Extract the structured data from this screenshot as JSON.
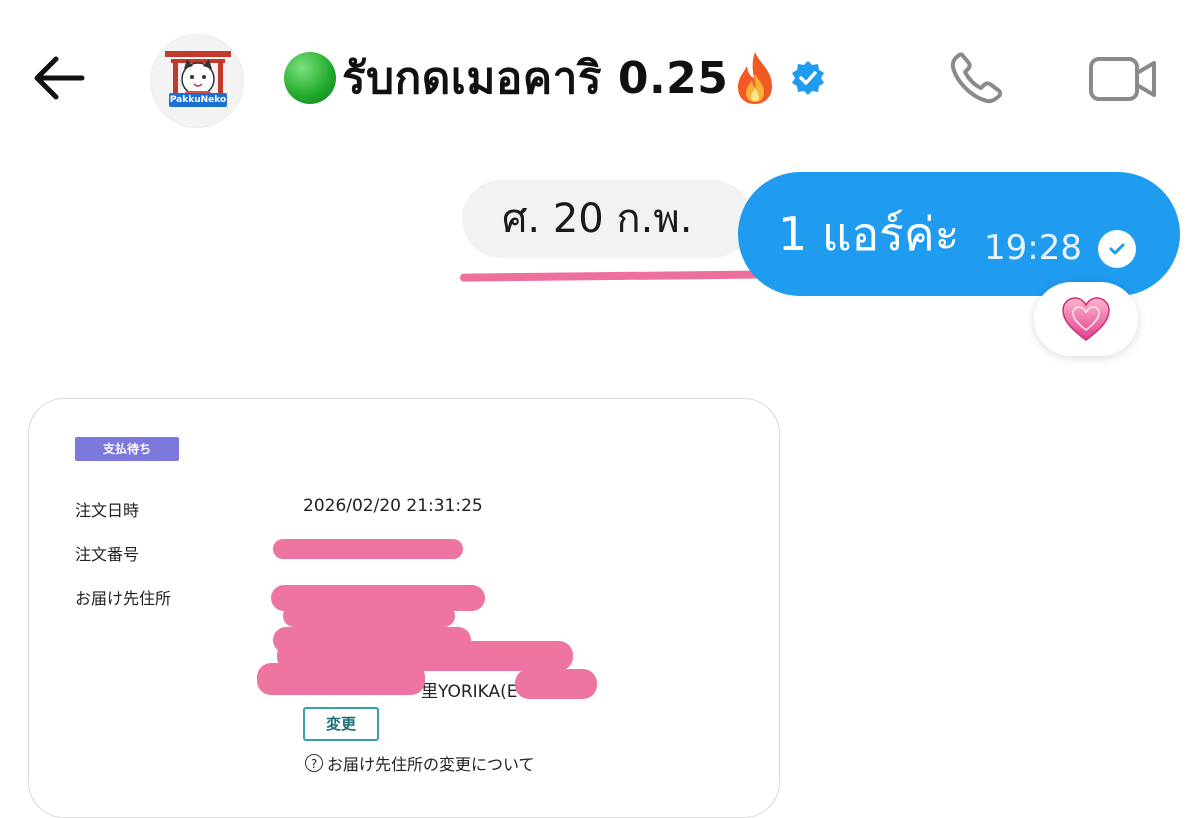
{
  "header": {
    "back_icon": "arrow-left-icon",
    "avatar_label": "PakkuNeko",
    "chat_title": "รับกดเมอคาริ 0.25",
    "status_color": "#1fa82a",
    "verified_color": "#1f9bf0",
    "call_icon": "phone-icon",
    "video_icon": "video-camera-icon"
  },
  "conversation": {
    "date_separator": "ศ. 20 ก.พ.",
    "outgoing_message": {
      "text": "1 แอร์ค่ะ",
      "time": "19:28",
      "status_icon": "read-check-icon",
      "bubble_color": "#1f9bf0"
    },
    "reaction": "💗"
  },
  "order_card": {
    "status_badge": "支払待ち",
    "fields": [
      {
        "label": "注文日時",
        "value": "2026/02/20 21:31:25"
      },
      {
        "label": "注文番号",
        "value": ""
      },
      {
        "label": "お届け先住所",
        "value": ""
      }
    ],
    "partial_address": "里YORIKA(E",
    "change_button": "変更",
    "help_text": "お届け先住所の変更について",
    "redaction_color": "#ee74a1"
  }
}
